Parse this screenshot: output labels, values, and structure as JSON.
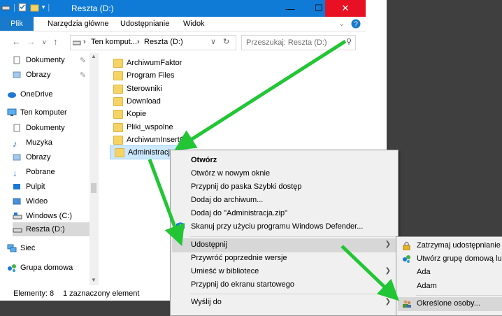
{
  "window": {
    "title": "Reszta (D:)"
  },
  "ribbon": {
    "tabs": [
      "Plik",
      "Narzędzia główne",
      "Udostępnianie",
      "Widok"
    ]
  },
  "address": {
    "crumb1": "Ten komput...",
    "crumb2": "Reszta (D:)",
    "search_placeholder": "Przeszukaj: Reszta (D:)"
  },
  "nav": {
    "items": [
      "Dokumenty",
      "Obrazy",
      "OneDrive",
      "Ten komputer",
      "Dokumenty",
      "Muzyka",
      "Obrazy",
      "Pobrane",
      "Pulpit",
      "Wideo",
      "Windows (C:)",
      "Reszta (D:)",
      "Sieć",
      "Grupa domowa"
    ]
  },
  "files": {
    "items": [
      "ArchiwumFaktor",
      "Program Files",
      "Sterowniki",
      "Download",
      "Kopie",
      "Pliki_wspolne",
      "ArchiwumInsertGT",
      "Administracja"
    ]
  },
  "status": {
    "count": "Elementy: 8",
    "selected": "1 zaznaczony element"
  },
  "context_menu": {
    "items": [
      "Otwórz",
      "Otwórz w nowym oknie",
      "Przypnij do paska Szybki dostęp",
      "Dodaj do archiwum...",
      "Dodaj do \"Administracja.zip\"",
      "Skanuj przy użyciu programu Windows Defender...",
      "Udostępnij",
      "Przywróć poprzednie wersje",
      "Umieść w bibliotece",
      "Przypnij do ekranu startowego",
      "Wyślij do"
    ]
  },
  "submenu": {
    "items": [
      "Zatrzymaj udostępnianie",
      "Utwórz grupę domową lub",
      "Ada",
      "Adam",
      "Określone osoby..."
    ]
  },
  "colors": {
    "accent": "#0f7bd6",
    "arrow": "#22c635"
  },
  "icons": [
    "pin-icon",
    "onedrive-icon",
    "computer-icon",
    "music-icon",
    "download-icon",
    "video-icon",
    "drive-icon",
    "network-icon",
    "homegroup-icon",
    "defender-icon",
    "lock-icon",
    "people-icon"
  ]
}
